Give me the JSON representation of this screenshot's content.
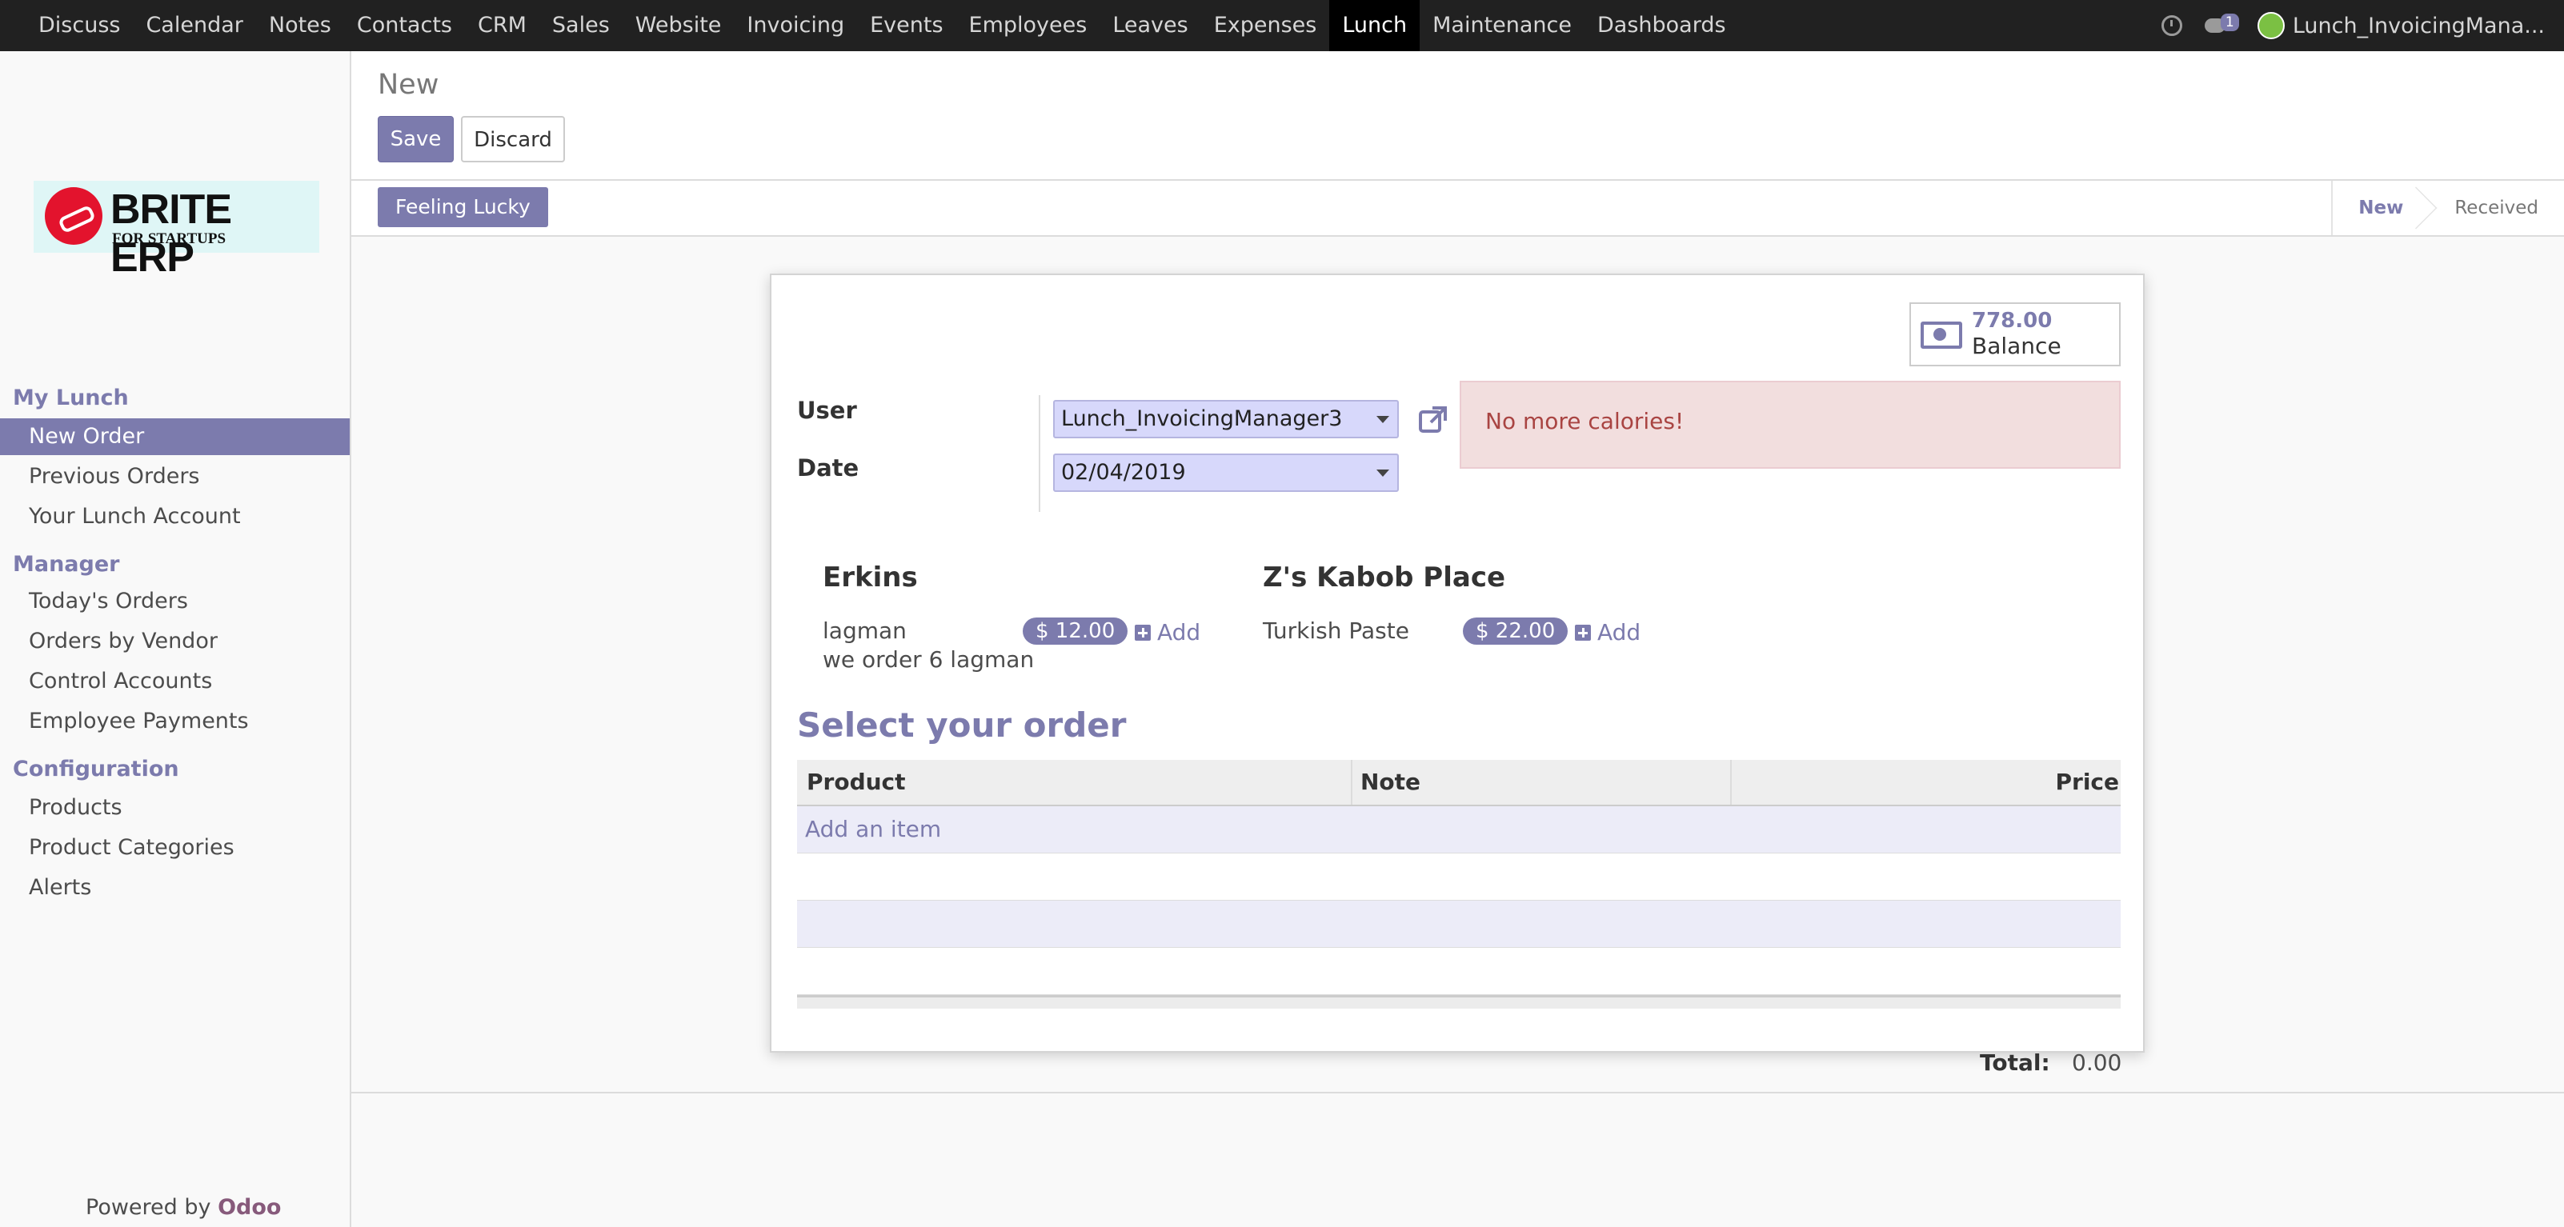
{
  "topbar": {
    "menu": [
      "Discuss",
      "Calendar",
      "Notes",
      "Contacts",
      "CRM",
      "Sales",
      "Website",
      "Invoicing",
      "Events",
      "Employees",
      "Leaves",
      "Expenses",
      "Lunch",
      "Maintenance",
      "Dashboards"
    ],
    "active": "Lunch",
    "chat_count": "1",
    "user": "Lunch_InvoicingMana..."
  },
  "sidebar": {
    "logo": {
      "brand": "BRITE ERP",
      "tagline": "FOR STARTUPS"
    },
    "sections": [
      {
        "title": "My Lunch",
        "items": [
          "New Order",
          "Previous Orders",
          "Your Lunch Account"
        ]
      },
      {
        "title": "Manager",
        "items": [
          "Today's Orders",
          "Orders by Vendor",
          "Control Accounts",
          "Employee Payments"
        ]
      },
      {
        "title": "Configuration",
        "items": [
          "Products",
          "Product Categories",
          "Alerts"
        ]
      }
    ],
    "active_item": "New Order",
    "powered_prefix": "Powered by",
    "powered_brand": "Odoo"
  },
  "control": {
    "breadcrumb": "New",
    "save_label": "Save",
    "discard_label": "Discard"
  },
  "statusbar": {
    "lucky_label": "Feeling Lucky",
    "stages": [
      "New",
      "Received"
    ],
    "current_stage": "New"
  },
  "form": {
    "balance_value": "778.00",
    "balance_label": "Balance",
    "user_label": "User",
    "user_value": "Lunch_InvoicingManager3",
    "date_label": "Date",
    "date_value": "02/04/2019",
    "alert": "No more calories!",
    "vendors": [
      {
        "name": "Erkins",
        "product": "lagman",
        "price": "$ 12.00",
        "note": "we order 6 lagman",
        "add": "Add"
      },
      {
        "name": "Z's Kabob Place",
        "product": "Turkish Paste",
        "price": "$ 22.00",
        "add": "Add"
      }
    ],
    "section_title": "Select your order",
    "columns": [
      "Product",
      "Note",
      "Price"
    ],
    "add_item": "Add an item",
    "total_label": "Total:",
    "total_value": "0.00"
  },
  "colors": {
    "accent": "#7c7bad",
    "topbar": "#212121",
    "alert_bg": "#f2dede",
    "alert_text": "#a94442"
  }
}
